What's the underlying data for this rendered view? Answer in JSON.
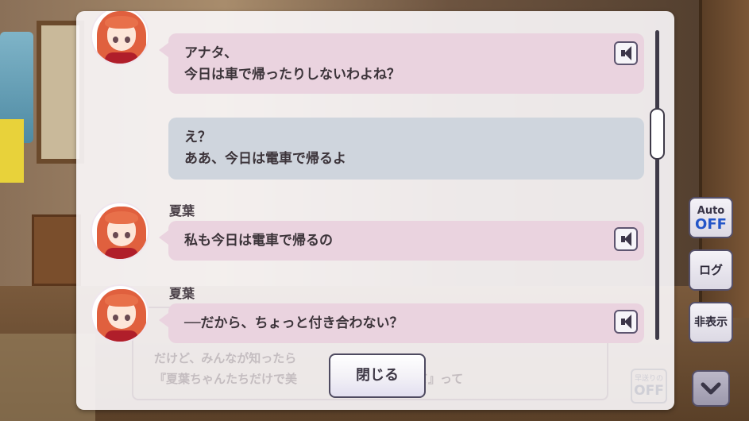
{
  "dialog_log": {
    "entries": [
      {
        "speaker": "",
        "lines": [
          "アナタ、",
          "今日は車で帰ったりしないわよね？"
        ],
        "is_player": false,
        "has_voice": true
      },
      {
        "speaker": "",
        "lines": [
          "え？",
          "ああ、今日は電車で帰るよ"
        ],
        "is_player": true,
        "has_voice": false
      },
      {
        "speaker": "夏葉",
        "lines": [
          "私も今日は電車で帰るの"
        ],
        "is_player": false,
        "has_voice": true
      },
      {
        "speaker": "夏葉",
        "lines": [
          "──だから、ちょっと付き合わない？"
        ],
        "is_player": false,
        "has_voice": true
      }
    ],
    "close_label": "閉じる",
    "scroll_position": 0.3
  },
  "background_dialog": {
    "line1": "だけど、みんなが知ったら",
    "line2": "『夏葉ちゃんたちだけで美",
    "line2_end": "て』って",
    "toggle_top": "早送りの",
    "toggle_value": "OFF"
  },
  "side_controls": {
    "auto_label": "Auto",
    "auto_state": "OFF",
    "log_label": "ログ",
    "hide_label": "非表示",
    "auto_state_color": "#2456c8"
  },
  "icons": {
    "voice": "speaker-icon",
    "down": "chevron-down-icon"
  }
}
